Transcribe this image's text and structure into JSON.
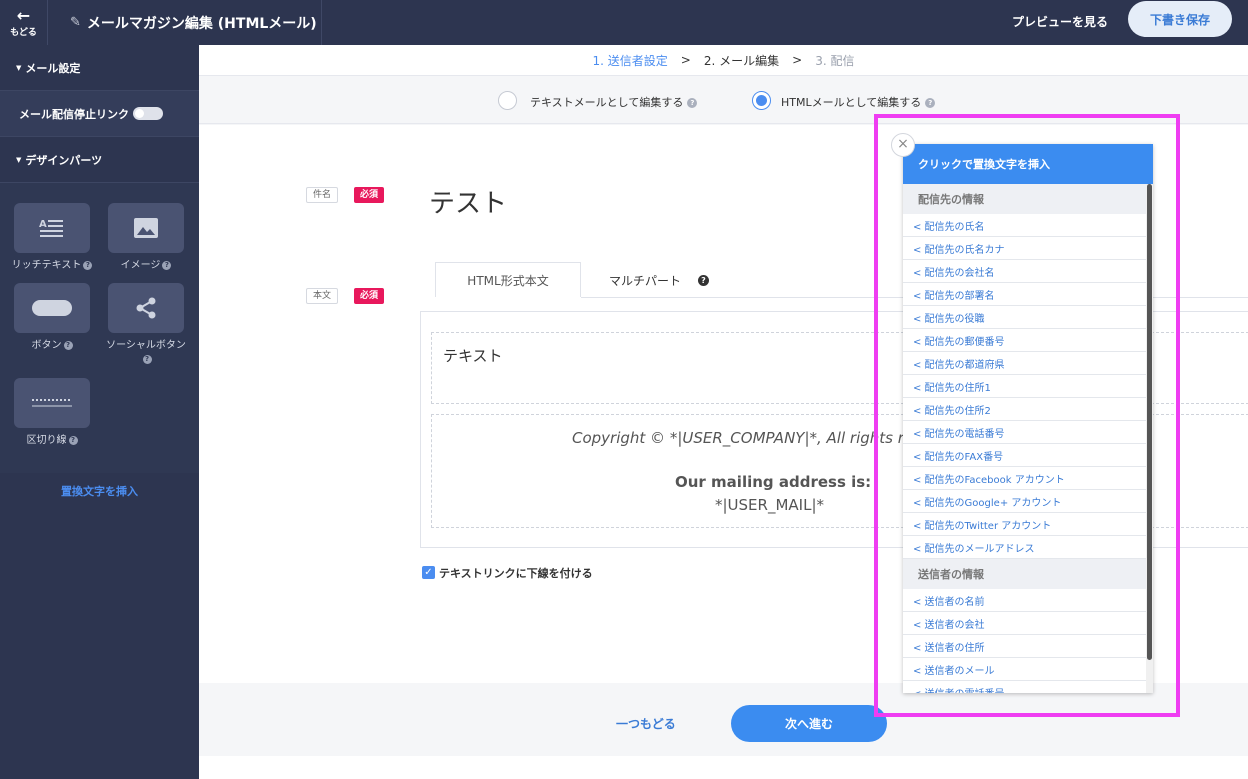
{
  "topbar": {
    "back_label": "もどる",
    "title": "メールマガジン編集 (HTMLメール)",
    "preview": "プレビューを見る",
    "save_draft": "下書き保存"
  },
  "sidebar": {
    "mail_settings": "メール設定",
    "unsubscribe_link": "メール配信停止リンク",
    "design_parts": "デザインパーツ",
    "parts": {
      "rich_text": "リッチテキスト",
      "image": "イメージ",
      "button": "ボタン",
      "social": "ソーシャルボタン",
      "divider": "区切り線"
    },
    "insert_text": "置換文字を挿入"
  },
  "steps": {
    "step1": "1. 送信者設定",
    "sep1": ">",
    "step2": "2. メール編集",
    "sep2": ">",
    "step3": "3. 配信"
  },
  "mode": {
    "text_mode": "テキストメールとして編集する",
    "html_mode": "HTMLメールとして編集する",
    "selected": "html"
  },
  "form": {
    "subject_tag": "件名",
    "required": "必須",
    "subject_value": "テスト",
    "body_tag": "本文",
    "tab_html": "HTML形式本文",
    "tab_multipart": "マルチパート",
    "body_text": "テキスト",
    "copyright": "Copyright © *|USER_COMPANY|*, All rights r",
    "mailing_address": "Our mailing address is:",
    "user_mail": "*|USER_MAIL|*",
    "underline_links": "テキストリンクに下線を付ける",
    "underline_checked": true
  },
  "footer": {
    "back": "一つもどる",
    "next": "次へ進む"
  },
  "popup": {
    "title": "クリックで置換文字を挿入",
    "close": "×",
    "section_recipient": "配信先の情報",
    "recipient_items": [
      "< 配信先の氏名",
      "< 配信先の氏名カナ",
      "< 配信先の会社名",
      "< 配信先の部署名",
      "< 配信先の役職",
      "< 配信先の郵便番号",
      "< 配信先の都道府県",
      "< 配信先の住所1",
      "< 配信先の住所2",
      "< 配信先の電話番号",
      "< 配信先のFAX番号",
      "< 配信先のFacebook アカウント",
      "< 配信先のGoogle+ アカウント",
      "< 配信先のTwitter アカウント",
      "< 配信先のメールアドレス"
    ],
    "section_sender": "送信者の情報",
    "sender_items": [
      "< 送信者の名前",
      "< 送信者の会社",
      "< 送信者の住所",
      "< 送信者のメール",
      "< 送信者の電話番号"
    ]
  },
  "colors": {
    "navy": "#2d3550",
    "accent": "#3b8cf0",
    "required": "#e8185c",
    "highlight": "#ef3df2"
  }
}
